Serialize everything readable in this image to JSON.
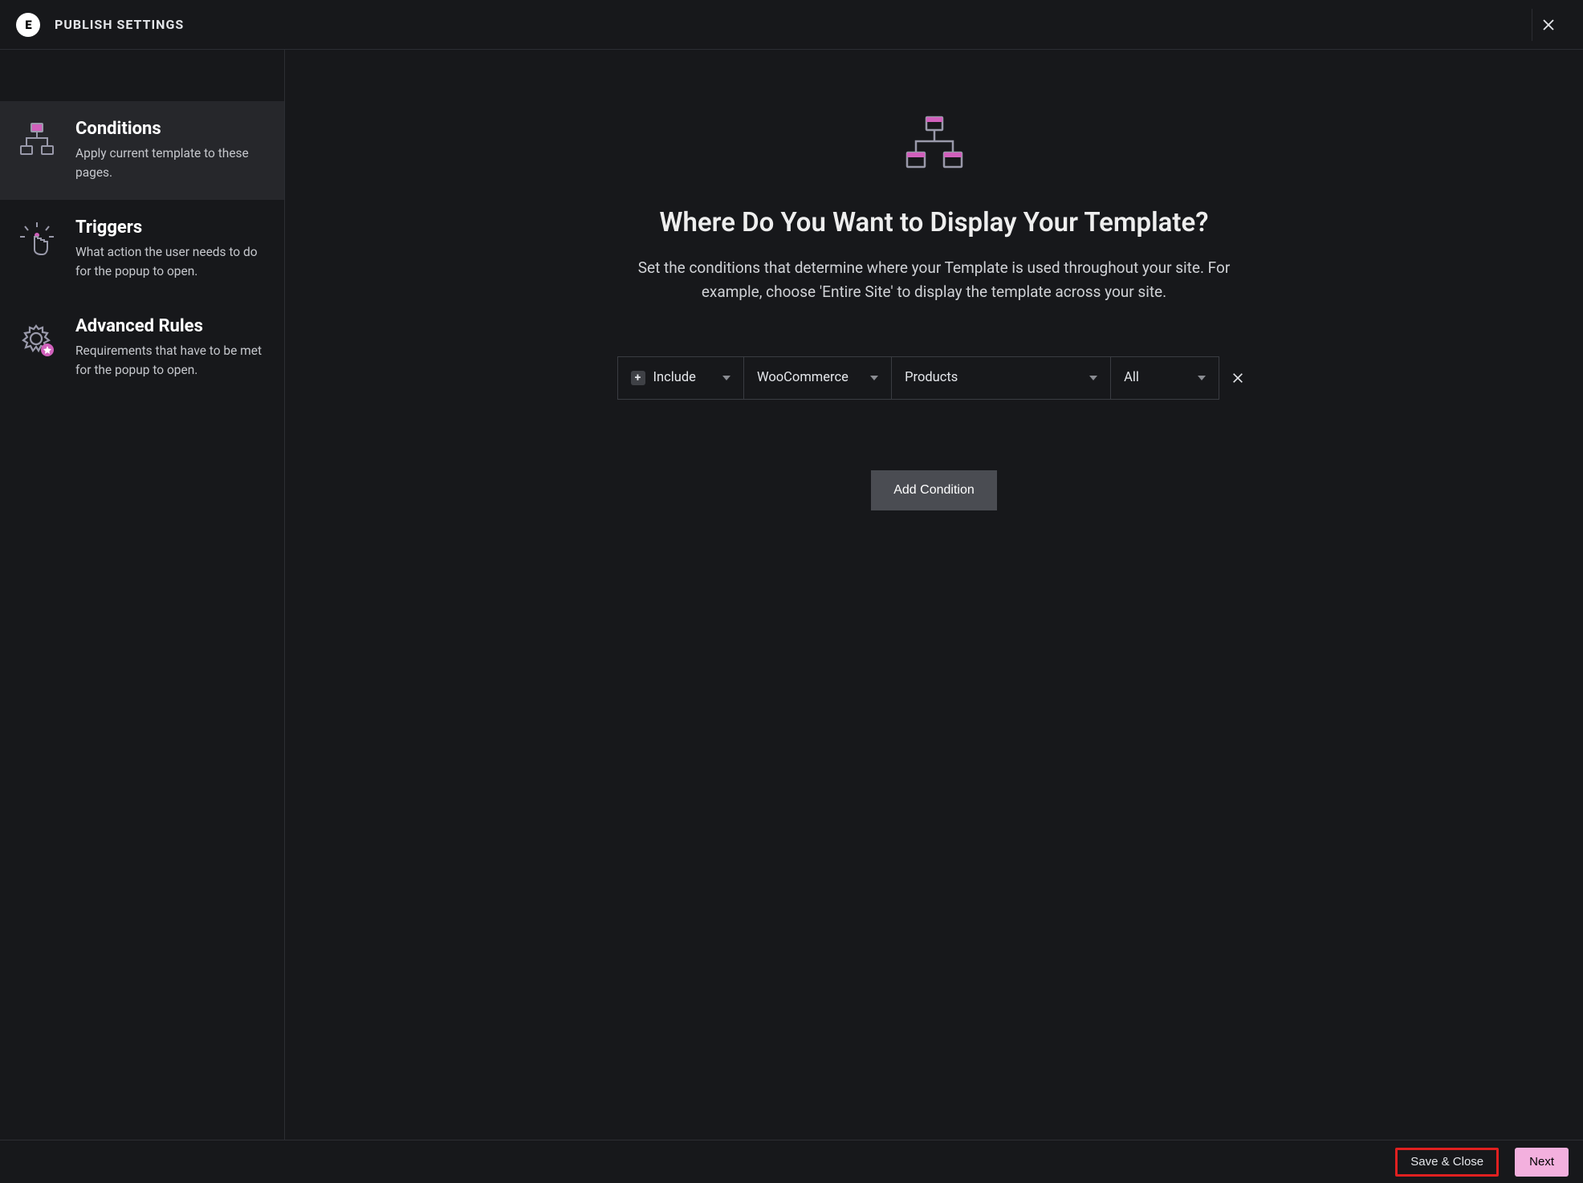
{
  "header": {
    "title": "PUBLISH SETTINGS",
    "logo_text": "E"
  },
  "sidebar": {
    "items": [
      {
        "title": "Conditions",
        "desc": "Apply current template to these pages."
      },
      {
        "title": "Triggers",
        "desc": "What action the user needs to do for the popup to open."
      },
      {
        "title": "Advanced Rules",
        "desc": "Requirements that have to be met for the popup to open."
      }
    ]
  },
  "main": {
    "heading": "Where Do You Want to Display Your Template?",
    "description": "Set the conditions that determine where your Template is used throughout your site. For example, choose 'Entire Site' to display the template across your site.",
    "condition": {
      "mode": "Include",
      "source": "WooCommerce",
      "post_type": "Products",
      "scope": "All"
    },
    "add_condition_label": "Add Condition"
  },
  "footer": {
    "save_close": "Save & Close",
    "next": "Next"
  },
  "colors": {
    "accent_pink": "#d160bc",
    "accent_pink_light": "#f3b0de"
  }
}
